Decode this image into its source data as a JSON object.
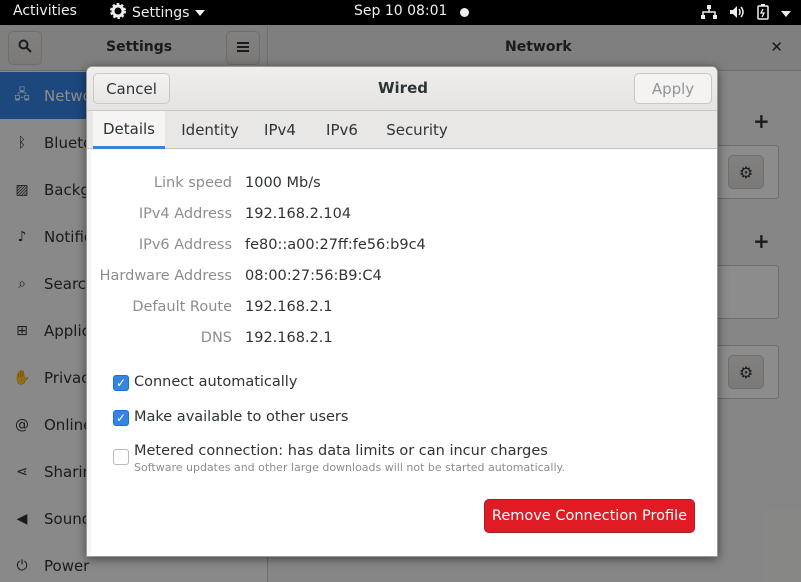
{
  "topbar": {
    "activities": "Activities",
    "app_menu": "Settings",
    "clock": "Sep 10  08:01",
    "tray_icons": [
      "network-icon",
      "volume-icon",
      "battery-icon",
      "chevron-down-icon"
    ]
  },
  "settings": {
    "sidebar_title": "Settings",
    "panel_title": "Network",
    "sidebar_items": [
      {
        "label": "Network",
        "icon": "network-icon",
        "selected": true
      },
      {
        "label": "Bluetooth",
        "icon": "bluetooth-icon"
      },
      {
        "label": "Background",
        "icon": "background-icon"
      },
      {
        "label": "Notifications",
        "icon": "bell-icon"
      },
      {
        "label": "Search",
        "icon": "search-icon"
      },
      {
        "label": "Applications",
        "icon": "grid-icon"
      },
      {
        "label": "Privacy",
        "icon": "hand-icon"
      },
      {
        "label": "Online Accounts",
        "icon": "at-icon"
      },
      {
        "label": "Sharing",
        "icon": "share-icon"
      },
      {
        "label": "Sound",
        "icon": "speaker-icon"
      },
      {
        "label": "Power",
        "icon": "power-icon"
      }
    ]
  },
  "dialog": {
    "title": "Wired",
    "cancel_label": "Cancel",
    "apply_label": "Apply",
    "tabs": [
      "Details",
      "Identity",
      "IPv4",
      "IPv6",
      "Security"
    ],
    "active_tab": "Details",
    "details": [
      {
        "label": "Link speed",
        "value": "1000 Mb/s"
      },
      {
        "label": "IPv4 Address",
        "value": "192.168.2.104"
      },
      {
        "label": "IPv6 Address",
        "value": "fe80::a00:27ff:fe56:b9c4"
      },
      {
        "label": "Hardware Address",
        "value": "08:00:27:56:B9:C4"
      },
      {
        "label": "Default Route",
        "value": "192.168.2.1"
      },
      {
        "label": "DNS",
        "value": "192.168.2.1"
      }
    ],
    "checks": [
      {
        "label": "Connect automatically",
        "checked": true
      },
      {
        "label": "Make available to other users",
        "checked": true
      },
      {
        "label": "Metered connection: has data limits or can incur charges",
        "sub": "Software updates and other large downloads will not be started automatically.",
        "checked": false
      }
    ],
    "remove_label": "Remove Connection Profile"
  },
  "colors": {
    "accent": "#3584e4",
    "danger": "#e01b24",
    "topbar": "#000000"
  }
}
